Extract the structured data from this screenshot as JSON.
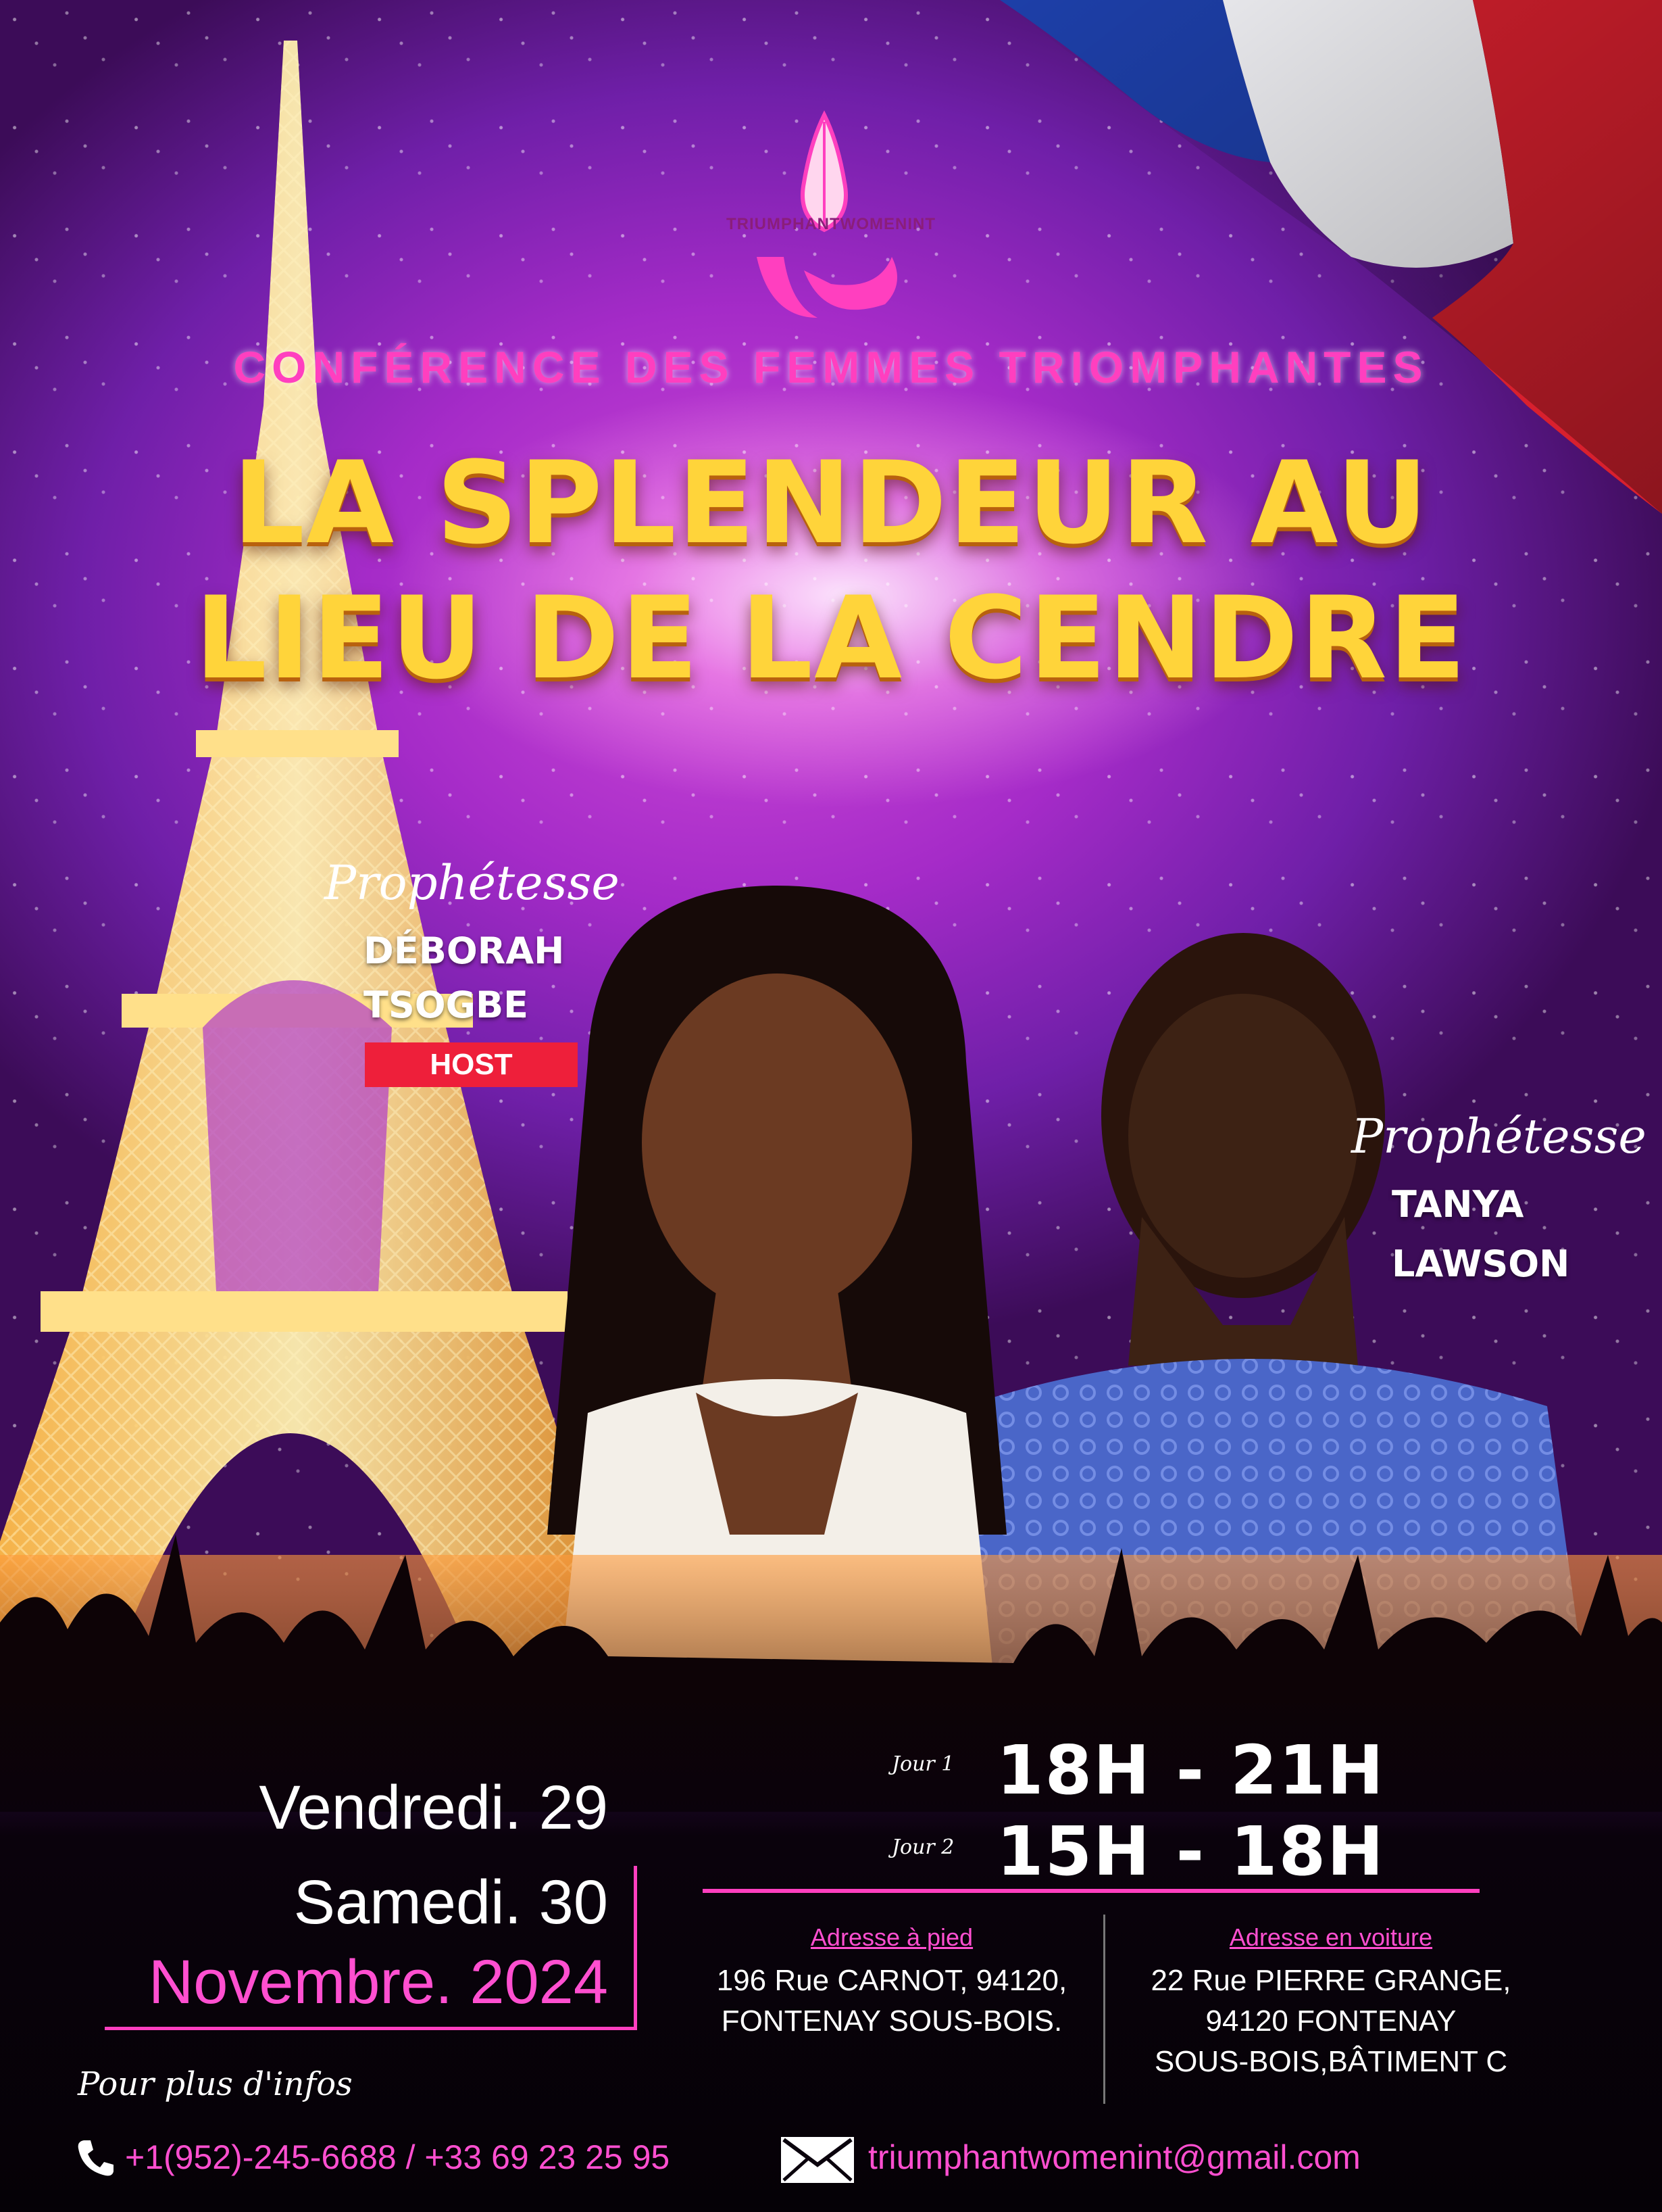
{
  "logo": {
    "brand": "TRIUMPHANTWOMENINT",
    "icon": "praying-hands-icon"
  },
  "header": {
    "subtitle": "CONFÉRENCE DES FEMMES TRIOMPHANTES",
    "title_line1": "LA SPLENDEUR AU",
    "title_line2": "LIEU DE LA CENDRE"
  },
  "speakers": [
    {
      "role_script": "Prophétesse",
      "first_name": "DÉBORAH",
      "last_name": "TSOGBE",
      "badge": "HOST"
    },
    {
      "role_script": "Prophétesse",
      "first_name": "TANYA",
      "last_name": "LAWSON"
    }
  ],
  "dates": {
    "day1": "Vendredi. 29",
    "day2": "Samedi. 30",
    "month_year": "Novembre. 2024"
  },
  "schedule": [
    {
      "label": "Jour 1",
      "time": "18H - 21H"
    },
    {
      "label": "Jour 2",
      "time": "15H - 18H"
    }
  ],
  "addresses": {
    "walking": {
      "label": "Adresse à pied",
      "line1": "196 Rue CARNOT, 94120,",
      "line2": "FONTENAY SOUS-BOIS."
    },
    "driving": {
      "label": "Adresse en voiture",
      "line1": "22 Rue PIERRE GRANGE,",
      "line2": "94120 FONTENAY",
      "line3": "SOUS-BOIS,BÂTIMENT C"
    }
  },
  "contact": {
    "info_script": "Pour plus d'infos",
    "phones": "+1(952)-245-6688 / +33 69 23 25 95",
    "email": "triumphantwomenint@gmail.com",
    "phone_icon": "phone-icon",
    "email_icon": "envelope-icon"
  },
  "colors": {
    "accent_pink": "#ff3fbf",
    "title_gold": "#ffd43a",
    "badge_red": "#ee1f3a",
    "background_purple": "#a52bc8"
  }
}
